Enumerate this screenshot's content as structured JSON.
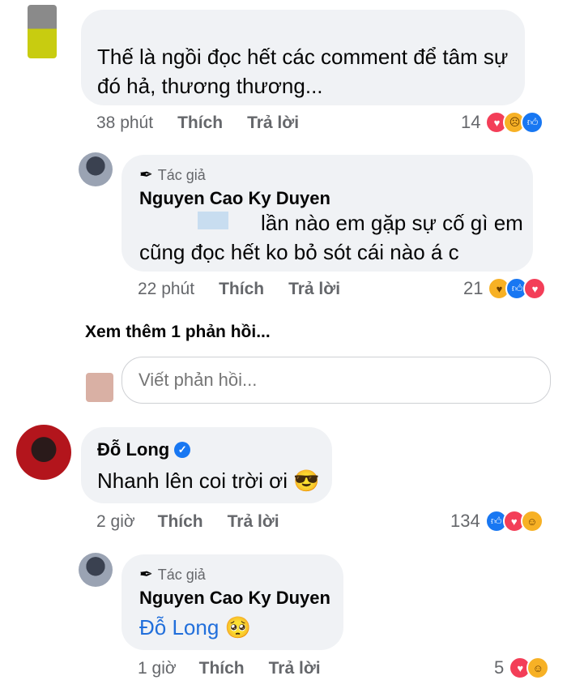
{
  "comments": [
    {
      "text": "Thế là ngồi đọc hết các comment để tâm sự đó hả, thương thương...",
      "time": "38 phút",
      "like_label": "Thích",
      "reply_label": "Trả lời",
      "reaction_count": "14",
      "reaction_icons": [
        "love-icon",
        "sad-icon",
        "like-icon"
      ]
    },
    {
      "author_tag": "Tác giả",
      "author": "Nguyen Cao Ky Duyen",
      "text": "lần nào em gặp sự cố gì em cũng đọc hết ko bỏ sót cái nào á c",
      "time": "22 phút",
      "like_label": "Thích",
      "reply_label": "Trả lời",
      "reaction_count": "21",
      "reaction_icons": [
        "care-icon",
        "like-icon",
        "love-icon"
      ]
    },
    {
      "author": "Đỗ Long",
      "text": "Nhanh lên coi trời ơi 😎",
      "time": "2 giờ",
      "like_label": "Thích",
      "reply_label": "Trả lời",
      "reaction_count": "134",
      "reaction_icons": [
        "like-icon",
        "love-icon",
        "haha-icon"
      ]
    },
    {
      "author_tag": "Tác giả",
      "author": "Nguyen Cao Ky Duyen",
      "mention": "Đỗ Long",
      "text_emoji": "🥺",
      "time": "1 giờ",
      "like_label": "Thích",
      "reply_label": "Trả lời",
      "reaction_count": "5",
      "reaction_icons": [
        "love-icon",
        "haha-icon"
      ]
    }
  ],
  "view_more": "Xem thêm 1 phản hồi...",
  "reply_input": {
    "placeholder": "Viết phản hồi..."
  },
  "colors": {
    "bubble": "#f0f2f5",
    "meta": "#65676b",
    "link": "#216fdb",
    "like": "#1877f2",
    "love": "#f33e58",
    "haha": "#f7b125"
  }
}
